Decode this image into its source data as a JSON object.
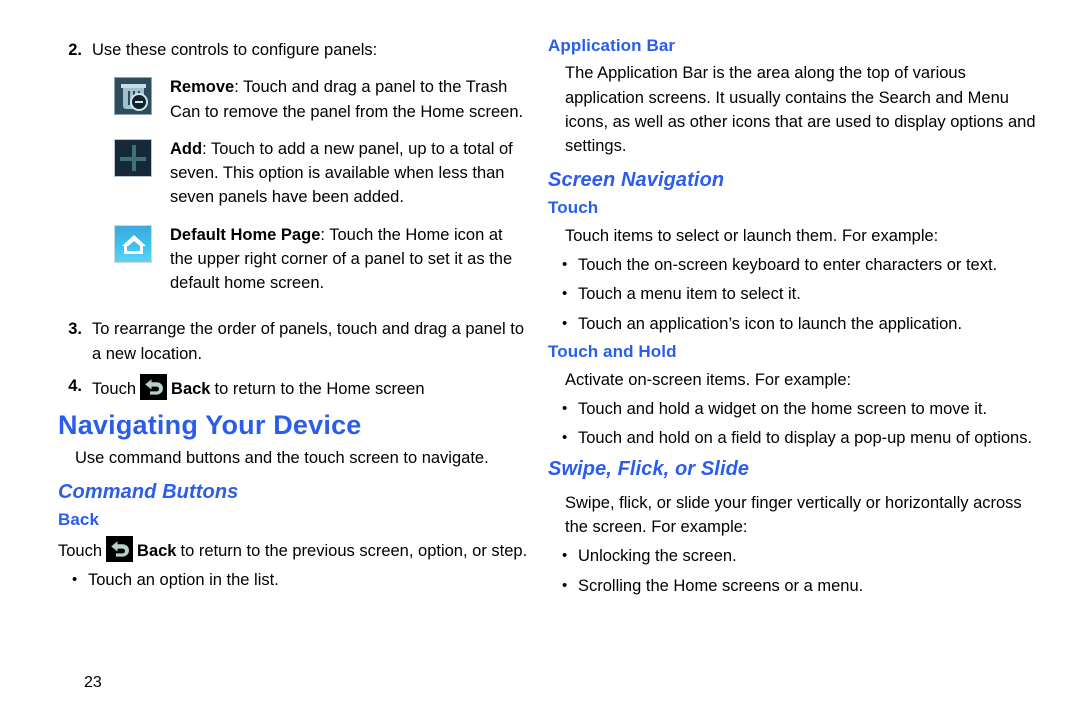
{
  "page": {
    "number": "23"
  },
  "left_column": {
    "step2": {
      "num": "2.",
      "text": "Use these controls to configure panels:"
    },
    "controls": [
      {
        "icon": "trash-can-remove-icon",
        "label": "Remove",
        "text": ": Touch and drag a panel to the Trash Can to remove the panel from the Home screen."
      },
      {
        "icon": "plus-add-icon",
        "label": "Add",
        "text": ": Touch to add a new panel, up to a total of seven. This option is available when less than seven panels have been added."
      },
      {
        "icon": "home-default-page-icon",
        "label": "Default Home Page",
        "text": ": Touch the Home icon at the upper right corner of a panel to set it as the default home screen."
      }
    ],
    "step3": {
      "num": "3.",
      "text": "To rearrange the order of panels, touch and drag a panel to a new location."
    },
    "step4": {
      "num": "4.",
      "prefix": "Touch",
      "icon": "back-arrow-icon",
      "bold": "Back",
      "suffix": "to return to the Home screen"
    },
    "heading_navigating": "Navigating Your Device",
    "intro": "Use command buttons and the touch screen to navigate.",
    "heading_command_buttons": "Command Buttons",
    "heading_back": "Back",
    "back_para": {
      "prefix": "Touch",
      "icon": "back-arrow-icon",
      "bold": "Back",
      "suffix": "to return to the previous screen, option, or step."
    },
    "back_bullets": [
      "Touch an option in the list."
    ]
  },
  "right_column": {
    "heading_application_bar": "Application Bar",
    "application_bar_para": "The Application Bar is the area along the top of various application screens. It usually contains the Search and Menu icons, as well as other icons that are used to display options and settings.",
    "heading_screen_navigation": "Screen Navigation",
    "heading_touch": "Touch",
    "touch_para": "Touch items to select or launch them. For example:",
    "touch_bullets": [
      "Touch the on-screen keyboard to enter characters or text.",
      "Touch a menu item to select it.",
      "Touch an application’s icon to launch the application."
    ],
    "heading_touch_and_hold": "Touch and Hold",
    "touch_hold_para": "Activate on-screen items. For example:",
    "touch_hold_bullets": [
      "Touch and hold a widget on the home screen to move it.",
      "Touch and hold on a field to display a pop-up menu of options."
    ],
    "heading_swipe": "Swipe, Flick, or Slide",
    "swipe_para": "Swipe, flick, or slide your finger vertically or horizontally across the screen. For example:",
    "swipe_bullets": [
      "Unlocking the screen.",
      "Scrolling the Home screens or a menu."
    ]
  },
  "bullet_glyph": "•",
  "colors": {
    "heading_blue": "#2b5ded",
    "body_black": "#000000",
    "page_background": "#ffffff"
  }
}
